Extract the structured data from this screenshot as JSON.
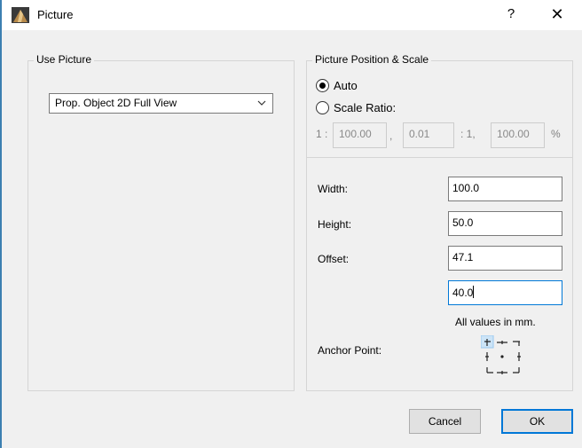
{
  "window": {
    "title": "Picture",
    "help": "?",
    "close": "✕"
  },
  "use_picture": {
    "group_label": "Use Picture",
    "dropdown_value": "Prop. Object 2D Full View"
  },
  "position_scale": {
    "group_label": "Picture Position & Scale",
    "auto_label": "Auto",
    "auto_selected": true,
    "scale_ratio_label": "Scale Ratio:",
    "ratio_prefix": "1 :",
    "ratio_value": "100.00",
    "comma": ",",
    "scale_value": "0.01",
    "ratio_suffix": ": 1,",
    "percent_value": "100.00",
    "percent_sign": "%"
  },
  "dimensions": {
    "width_label": "Width:",
    "width_value": "100.0",
    "height_label": "Height:",
    "height_value": "50.0",
    "offset_label": "Offset:",
    "offset_x_value": "47.1",
    "offset_y_value": "40.0",
    "units_note": "All values in mm.",
    "anchor_label": "Anchor Point:",
    "anchor_selected": "top-left"
  },
  "buttons": {
    "cancel": "Cancel",
    "ok": "OK"
  },
  "colors": {
    "accent": "#0078d7",
    "anchor_highlight": "#cce4f7"
  }
}
